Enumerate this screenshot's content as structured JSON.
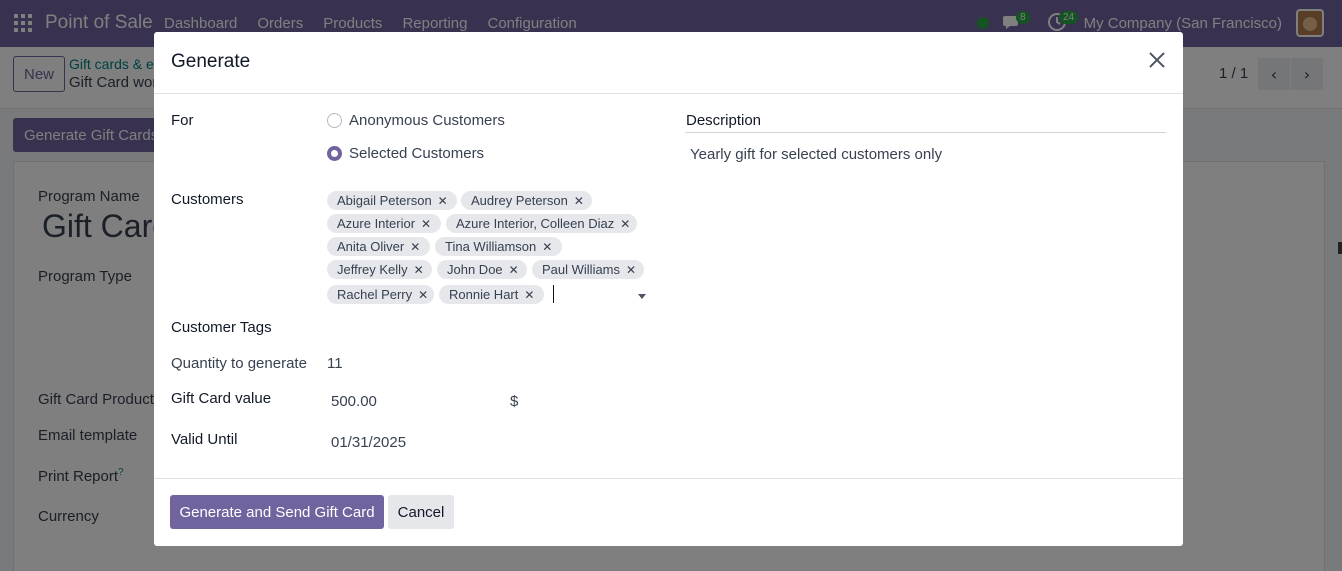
{
  "navbar": {
    "app_name": "Point of Sale",
    "menu": [
      "Dashboard",
      "Orders",
      "Products",
      "Reporting",
      "Configuration"
    ],
    "chat_count": "8",
    "activity_count": "24",
    "company": "My Company (San Francisco)",
    "colors": {
      "primary": "#71639e",
      "online": "#28a745"
    }
  },
  "control": {
    "new_label": "New",
    "breadcrumb_parent": "Gift cards & e",
    "breadcrumb_current": "Gift Card wor",
    "pager": "1 / 1"
  },
  "background_form": {
    "action_button": "Generate Gift Cards",
    "program_name_label": "Program Name",
    "program_name_value": "Gift Card",
    "program_type_label": "Program Type",
    "gift_card_product_label": "Gift Card Product",
    "email_template_label": "Email template",
    "print_report_label": "Print Report",
    "print_report_help": "?",
    "currency_label": "Currency"
  },
  "dialog": {
    "title": "Generate",
    "for_label": "For",
    "options": [
      {
        "label": "Anonymous Customers",
        "checked": false
      },
      {
        "label": "Selected Customers",
        "checked": true
      }
    ],
    "description_label": "Description",
    "description_value": "Yearly gift for selected customers only",
    "customers_label": "Customers",
    "customers": [
      "Abigail Peterson",
      "Audrey Peterson",
      "Azure Interior",
      "Azure Interior, Colleen Diaz",
      "Anita Oliver",
      "Tina Williamson",
      "Jeffrey Kelly",
      "John Doe",
      "Paul Williams",
      "Rachel Perry",
      "Ronnie Hart"
    ],
    "tag_remove": "✕",
    "customer_tags_label": "Customer Tags",
    "quantity_label": "Quantity to generate",
    "quantity_value": "11",
    "gift_card_value_label": "Gift Card value",
    "gift_card_value": "500.00",
    "currency_symbol": "$",
    "valid_until_label": "Valid Until",
    "valid_until_value": "01/31/2025",
    "primary_button": "Generate and Send Gift Card",
    "cancel_button": "Cancel"
  }
}
